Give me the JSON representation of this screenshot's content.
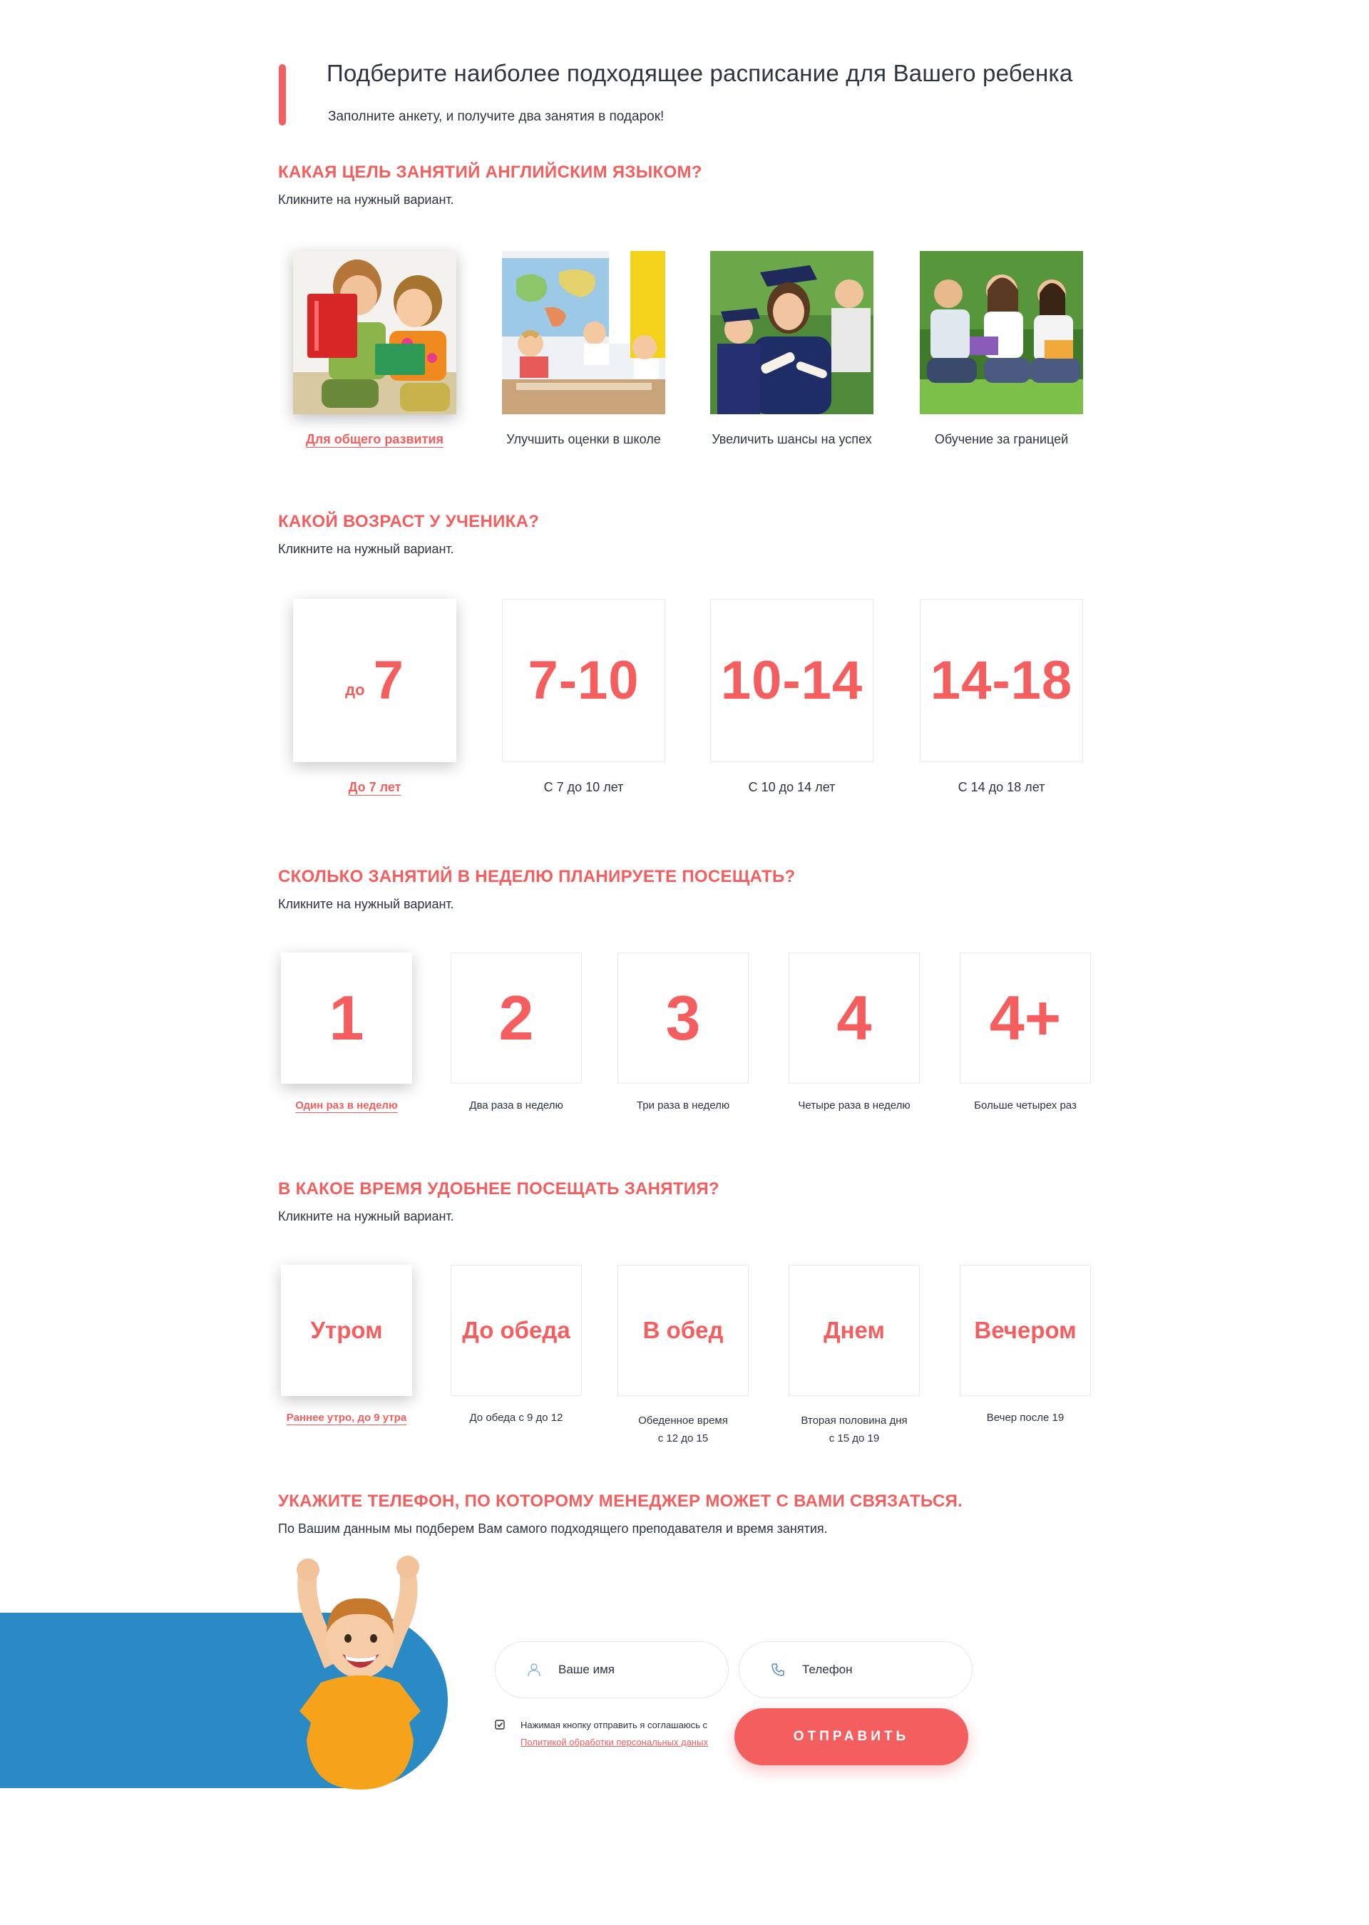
{
  "header": {
    "title": "Подберите наиболее подходящее расписание для Вашего ребенка",
    "subtitle": "Заполните анкету, и получите два занятия в подарок!"
  },
  "hint": "Кликните на нужный вариант.",
  "goal": {
    "question": "КАКАЯ ЦЕЛЬ ЗАНЯТИЙ АНГЛИЙСКИМ ЯЗЫКОМ?",
    "options": [
      {
        "label": "Для общего развития",
        "icon": "children-reading-photo",
        "selected": true
      },
      {
        "label": "Улучшить оценки в школе",
        "icon": "classroom-photo",
        "selected": false
      },
      {
        "label": "Увеличить шансы на успех",
        "icon": "graduates-photo",
        "selected": false
      },
      {
        "label": "Обучение за границей",
        "icon": "students-outdoors-photo",
        "selected": false
      }
    ]
  },
  "age": {
    "question": "КАКОЙ ВОЗРАСТ У УЧЕНИКА?",
    "options": [
      {
        "prefix": "до",
        "value": "7",
        "label": "До 7 лет",
        "selected": true
      },
      {
        "prefix": "",
        "value": "7-10",
        "label": "С 7 до 10 лет",
        "selected": false
      },
      {
        "prefix": "",
        "value": "10-14",
        "label": "С 10 до 14 лет",
        "selected": false
      },
      {
        "prefix": "",
        "value": "14-18",
        "label": "С 14 до 18 лет",
        "selected": false
      }
    ]
  },
  "frequency": {
    "question": "СКОЛЬКО ЗАНЯТИЙ В НЕДЕЛЮ ПЛАНИРУЕТЕ ПОСЕЩАТЬ?",
    "options": [
      {
        "value": "1",
        "label": "Один раз в неделю",
        "selected": true
      },
      {
        "value": "2",
        "label": "Два раза в неделю",
        "selected": false
      },
      {
        "value": "3",
        "label": "Три раза в неделю",
        "selected": false
      },
      {
        "value": "4",
        "label": "Четыре раза в неделю",
        "selected": false
      },
      {
        "value": "4+",
        "label": "Больше четырех раз",
        "selected": false
      }
    ]
  },
  "time": {
    "question": "В КАКОЕ ВРЕМЯ УДОБНЕЕ ПОСЕЩАТЬ ЗАНЯТИЯ?",
    "options": [
      {
        "value": "Утром",
        "label": "Раннее утро, до 9 утра",
        "label2": "",
        "selected": true
      },
      {
        "value": "До обеда",
        "label": "До обеда с 9 до 12",
        "label2": "",
        "selected": false
      },
      {
        "value": "В обед",
        "label": "Обеденное время",
        "label2": "с 12 до 15",
        "selected": false
      },
      {
        "value": "Днем",
        "label": "Вторая половина дня",
        "label2": "с 15 до 19",
        "selected": false
      },
      {
        "value": "Вечером",
        "label": "Вечер после 19",
        "label2": "",
        "selected": false
      }
    ]
  },
  "contact": {
    "question": "УКАЖИТЕ ТЕЛЕФОН, ПО КОТОРОМУ МЕНЕДЖЕР МОЖЕТ С ВАМИ СВЯЗАТЬСЯ.",
    "hint": "По Вашим данным мы подберем Вам самого подходящего преподавателя и время занятия.",
    "name_placeholder": "Ваше имя",
    "phone_placeholder": "Телефон",
    "consent_text": "Нажимая кнопку отправить я соглашаюсь с",
    "consent_link": "Политикой обработки персональных даных",
    "consent_checked": true,
    "submit_label": "ОТПРАВИТЬ"
  },
  "colors": {
    "accent": "#f45e5e",
    "blue": "#2a8ac6",
    "text": "#2c3440"
  }
}
